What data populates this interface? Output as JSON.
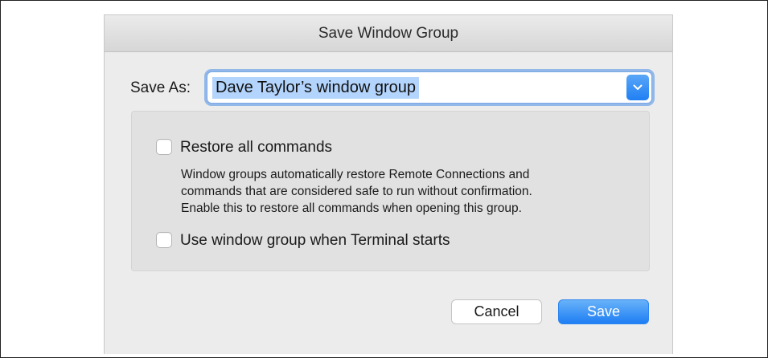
{
  "dialog": {
    "title": "Save Window Group",
    "save_as_label": "Save As:",
    "save_as_value": "Dave Taylor’s window group",
    "options": {
      "restore_all": {
        "label": "Restore all commands",
        "checked": false
      },
      "description_lines": [
        "Window groups automatically restore Remote Connections and",
        "commands that are considered safe to run without confirmation.",
        "Enable this to restore all commands when opening this group."
      ],
      "use_on_start": {
        "label": "Use window group when Terminal starts",
        "checked": false
      }
    },
    "buttons": {
      "cancel": "Cancel",
      "save": "Save"
    }
  },
  "icons": {
    "dropdown": "chevron-down-icon"
  },
  "colors": {
    "accent": "#1e7ef3",
    "selection": "#b3d4fc",
    "focus_ring": "#92b8ea"
  }
}
